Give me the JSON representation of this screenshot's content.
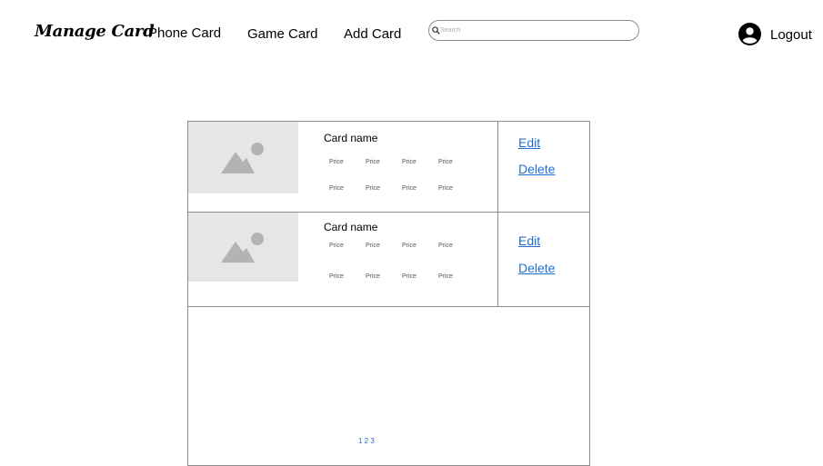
{
  "header": {
    "brand": "Manage Card",
    "nav": [
      "Phone Card",
      "Game Card",
      "Add Card"
    ],
    "search_placeholder": "Search",
    "search_icon": "search-icon",
    "user_icon": "user-circle-icon",
    "logout_label": "Logout"
  },
  "cards": [
    {
      "name": "Card name",
      "image_icon": "image-placeholder-icon",
      "prices": [
        "Price",
        "Price",
        "Price",
        "Price",
        "Price",
        "Price",
        "Price",
        "Price"
      ],
      "edit_label": "Edit",
      "delete_label": "Delete"
    },
    {
      "name": "Card name",
      "image_icon": "image-placeholder-icon",
      "prices": [
        "Price",
        "Price",
        "Price",
        "Price",
        "Price",
        "Price",
        "Price",
        "Price"
      ],
      "edit_label": "Edit",
      "delete_label": "Delete"
    }
  ],
  "pagination": "1 2 3",
  "colors": {
    "link": "#1f6fd1",
    "border": "#8c8c8c",
    "placeholder_bg": "#e6e6e6",
    "placeholder_fg": "#b3b3b3"
  }
}
